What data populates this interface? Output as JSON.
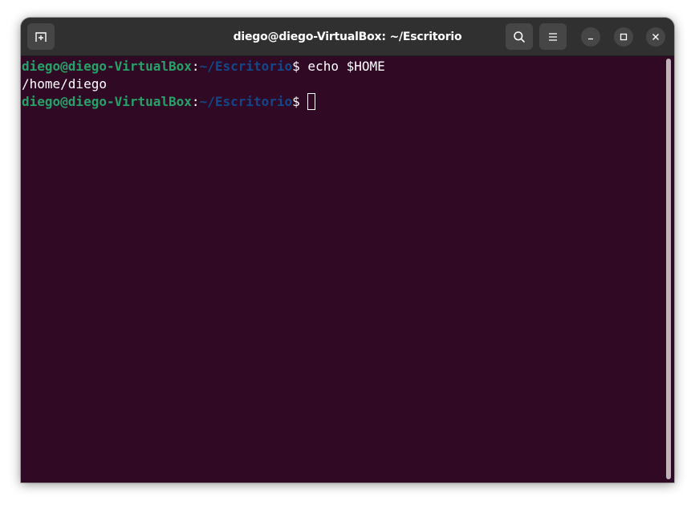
{
  "window": {
    "title": "diego@diego-VirtualBox: ~/Escritorio"
  },
  "headerbar": {
    "new_tab_icon": "new-tab-icon",
    "search_icon": "search-icon",
    "menu_icon": "hamburger-menu-icon",
    "minimize_icon": "minimize-icon",
    "maximize_icon": "maximize-icon",
    "close_icon": "close-icon"
  },
  "terminal": {
    "lines": [
      {
        "user_host": "diego@diego-VirtualBox",
        "sep": ":",
        "path": "~/Escritorio",
        "prompt": "$ ",
        "command": "echo $HOME"
      },
      {
        "output": "/home/diego"
      },
      {
        "user_host": "diego@diego-VirtualBox",
        "sep": ":",
        "path": "~/Escritorio",
        "prompt": "$ ",
        "command": ""
      }
    ]
  },
  "colors": {
    "terminal_bg": "#300a24",
    "user_host": "#26a269",
    "path": "#12488b",
    "headerbar_bg": "#303030",
    "button_bg": "#464646"
  }
}
